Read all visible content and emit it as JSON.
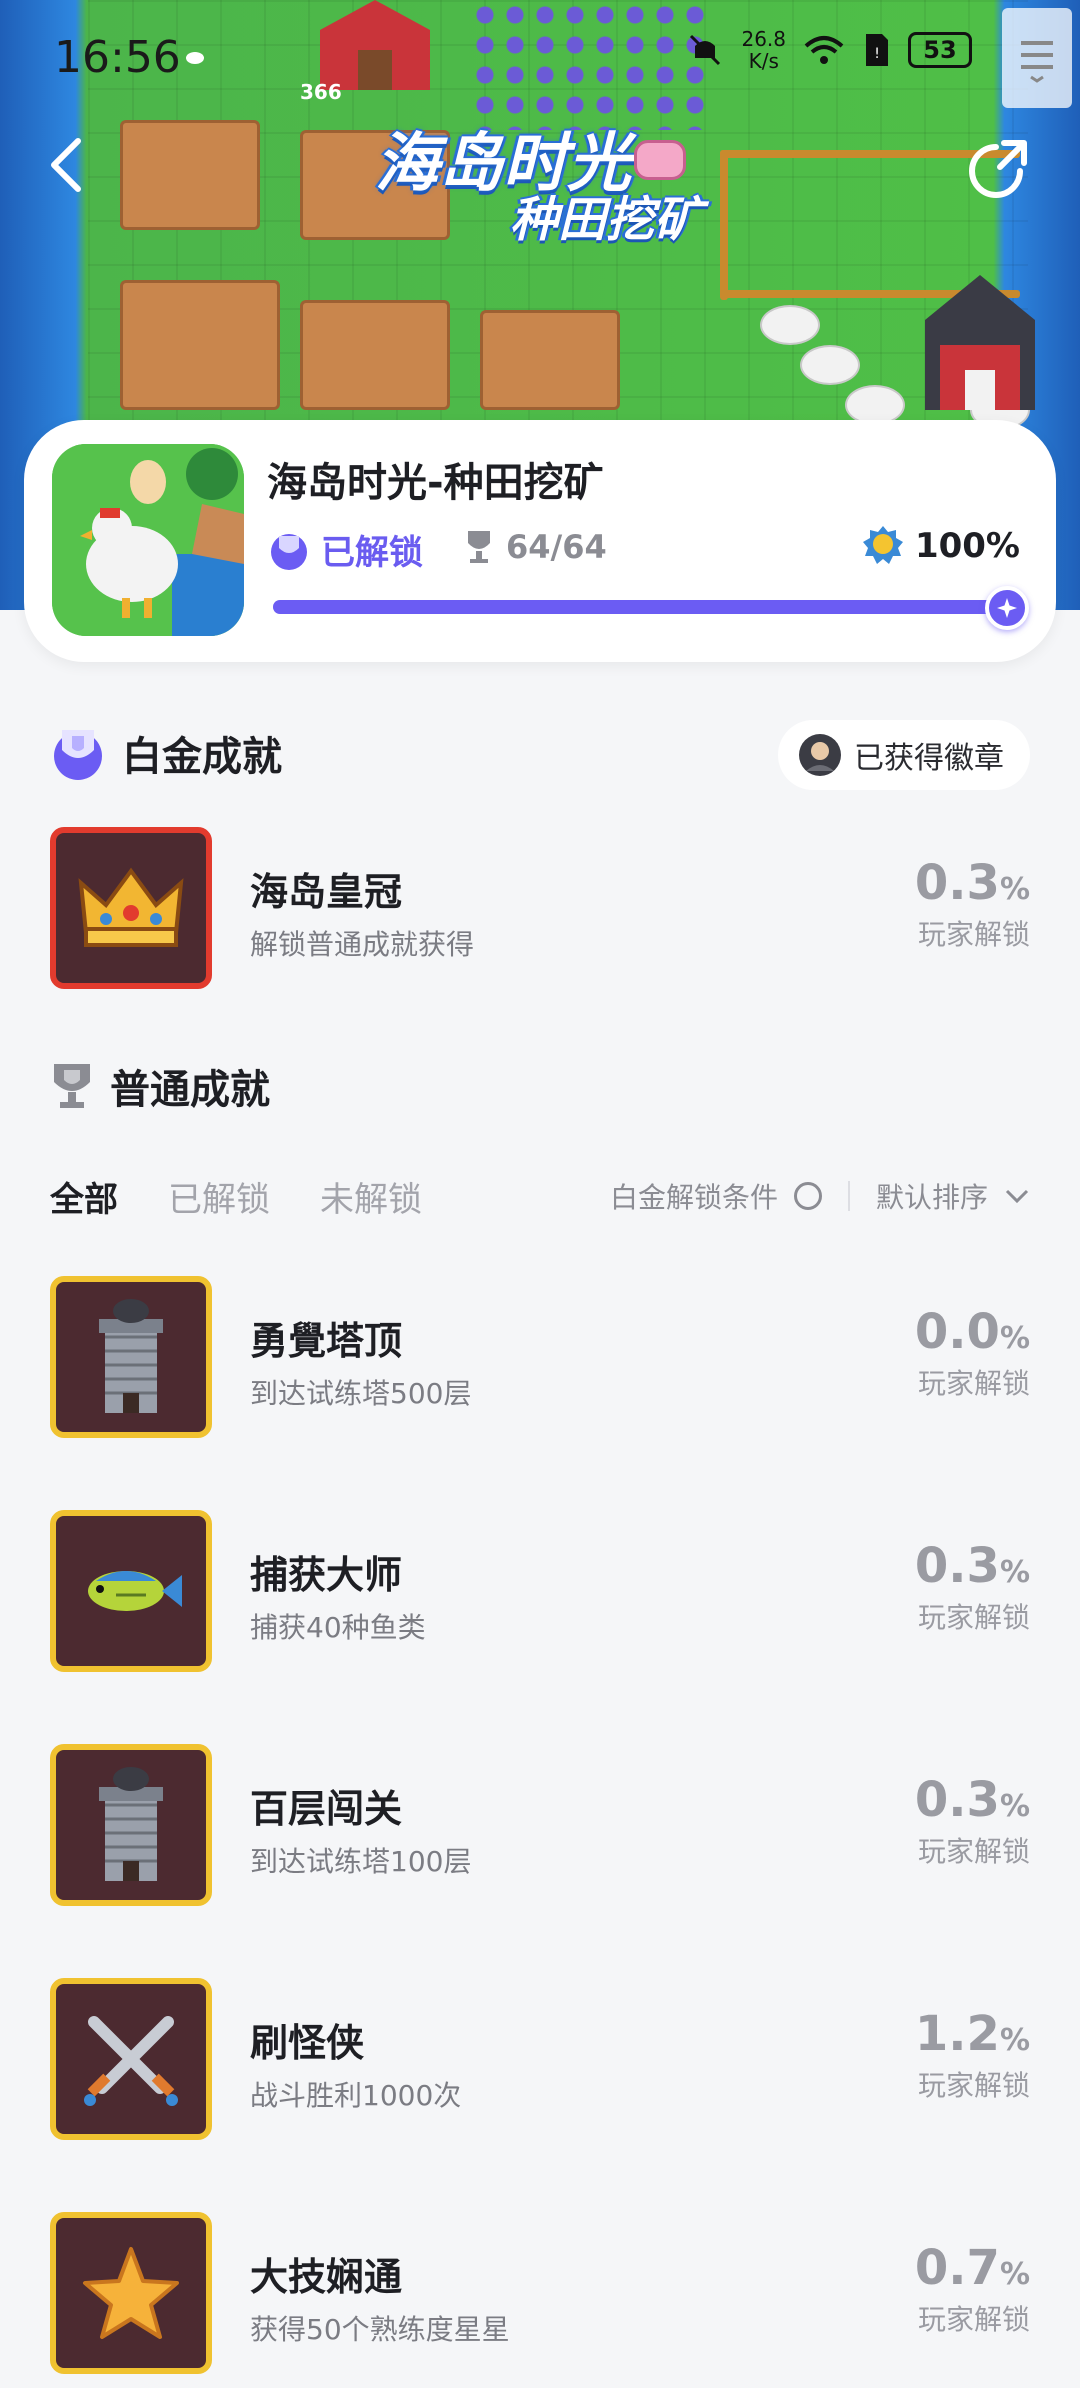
{
  "status_bar": {
    "time": "16:56",
    "net_speed_value": "26.8",
    "net_speed_unit": "K/s",
    "battery": "53"
  },
  "banner": {
    "title_line1": "海岛时光",
    "title_line2": "种田挖矿",
    "sprite_label": "366"
  },
  "game": {
    "title": "海岛时光-种田挖矿",
    "status": "已解锁",
    "trophies": "64/64",
    "completion": "100%",
    "progress_fraction": 1.0
  },
  "platinum": {
    "heading": "白金成就",
    "badge_button": "已获得徽章",
    "item": {
      "name": "海岛皇冠",
      "desc": "解锁普通成就获得",
      "rate": "0.3",
      "pct": "%",
      "label": "玩家解锁",
      "icon": "crown-icon"
    }
  },
  "normal": {
    "heading": "普通成就",
    "tabs": [
      "全部",
      "已解锁",
      "未解锁"
    ],
    "filter_condition": "白金解锁条件",
    "sort_label": "默认排序",
    "items": [
      {
        "name": "勇覺塔顶",
        "desc": "到达试练塔500层",
        "rate": "0.0",
        "pct": "%",
        "label": "玩家解锁",
        "icon": "tower-icon"
      },
      {
        "name": "捕获大师",
        "desc": "捕获40种鱼类",
        "rate": "0.3",
        "pct": "%",
        "label": "玩家解锁",
        "icon": "fish-icon"
      },
      {
        "name": "百层闯关",
        "desc": "到达试练塔100层",
        "rate": "0.3",
        "pct": "%",
        "label": "玩家解锁",
        "icon": "tower-icon"
      },
      {
        "name": "刷怪侠",
        "desc": "战斗胜利1000次",
        "rate": "1.2",
        "pct": "%",
        "label": "玩家解锁",
        "icon": "crossed-swords-icon"
      },
      {
        "name": "大技娴通",
        "desc": "获得50个熟练度星星",
        "rate": "0.7",
        "pct": "%",
        "label": "玩家解锁",
        "icon": "star-icon"
      }
    ]
  },
  "colors": {
    "accent": "#6b5cf3",
    "platinum_border": "#e23b2e",
    "gold_border": "#f0c230"
  }
}
